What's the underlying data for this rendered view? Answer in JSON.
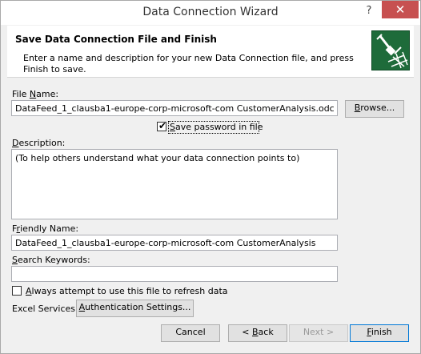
{
  "window": {
    "title": "Data Connection Wizard",
    "help_glyph": "?",
    "close_glyph": "✕"
  },
  "header": {
    "title": "Save Data Connection File and Finish",
    "description": "Enter a name and description for your new Data Connection file, and press Finish to save.",
    "icon": "connection-wizard-icon"
  },
  "file_name": {
    "label_pre": "File ",
    "label_ul": "N",
    "label_post": "ame:",
    "value": "DataFeed_1_clausba1-europe-corp-microsoft-com CustomerAnalysis.odc",
    "browse_label_ul": "B",
    "browse_label_post": "rowse..."
  },
  "save_password": {
    "checked": true,
    "label_ul": "S",
    "label_post": "ave password in file"
  },
  "description": {
    "label_ul": "D",
    "label_post": "escription:",
    "value": "(To help others understand what your data connection points to)"
  },
  "friendly_name": {
    "label_pre": "F",
    "label_ul": "r",
    "label_post": "iendly Name:",
    "value": "DataFeed_1_clausba1-europe-corp-microsoft-com CustomerAnalysis"
  },
  "search_keywords": {
    "label_ul": "S",
    "label_post": "earch Keywords:",
    "value": ""
  },
  "always_attempt": {
    "checked": false,
    "label_ul": "A",
    "label_post": "lways attempt to use this file to refresh data"
  },
  "excel_services": {
    "label": "Excel Services:",
    "auth_label_ul": "A",
    "auth_label_post": "uthentication Settings..."
  },
  "footer": {
    "cancel_label": "Cancel",
    "back_pre": "< ",
    "back_ul": "B",
    "back_post": "ack",
    "next_label": "Next >",
    "finish_ul": "F",
    "finish_post": "inish"
  }
}
